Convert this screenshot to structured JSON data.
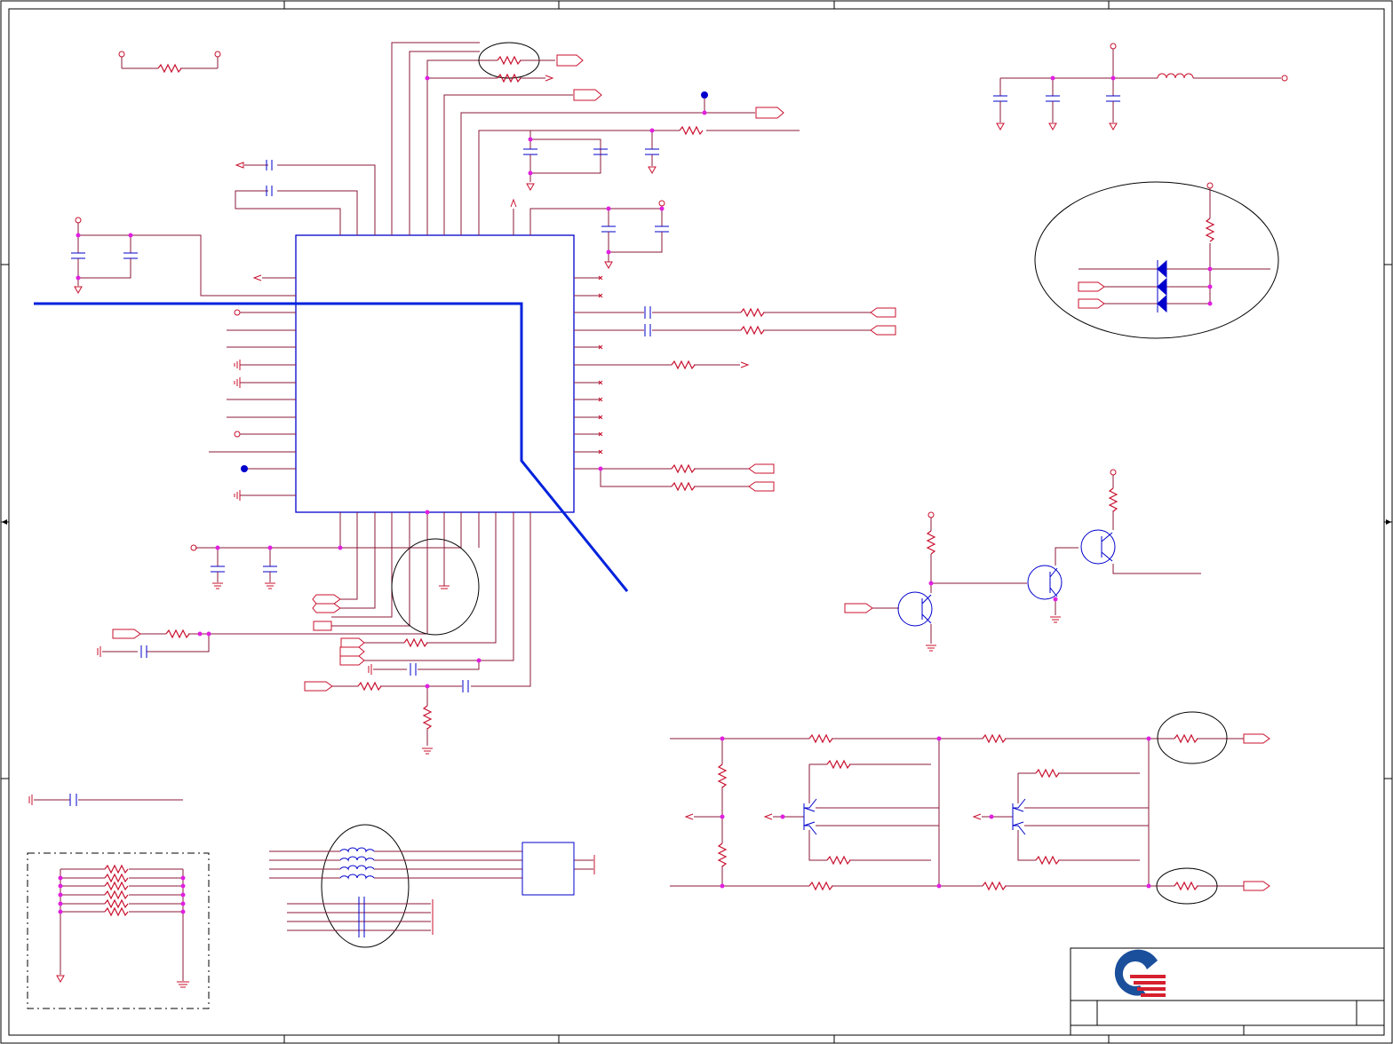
{
  "sheet": {
    "zones": {
      "columns": 5,
      "rows": 4
    },
    "title_block": {
      "logo": "company-logo"
    }
  },
  "colors": {
    "wire": "#8b1a3a",
    "symbol": "#c8102e",
    "component": "#0000cc",
    "junction": "#e020e0",
    "frame": "#000000",
    "highlight_line": "#0022dd",
    "logo_blue": "#1a4f9c",
    "logo_red": "#d6202e"
  },
  "blocks": {
    "main_ic": "ic-package",
    "input_filter": "rc-filter",
    "power_filter": "lc-filter",
    "diode_array": "esd-diode-array",
    "transistor_chain": "switch-chain",
    "bridge": "transistor-bridge",
    "common_mode": "common-mode-choke",
    "resistor_network": "resistor-array"
  },
  "highlight": {
    "style": "strike-through"
  }
}
